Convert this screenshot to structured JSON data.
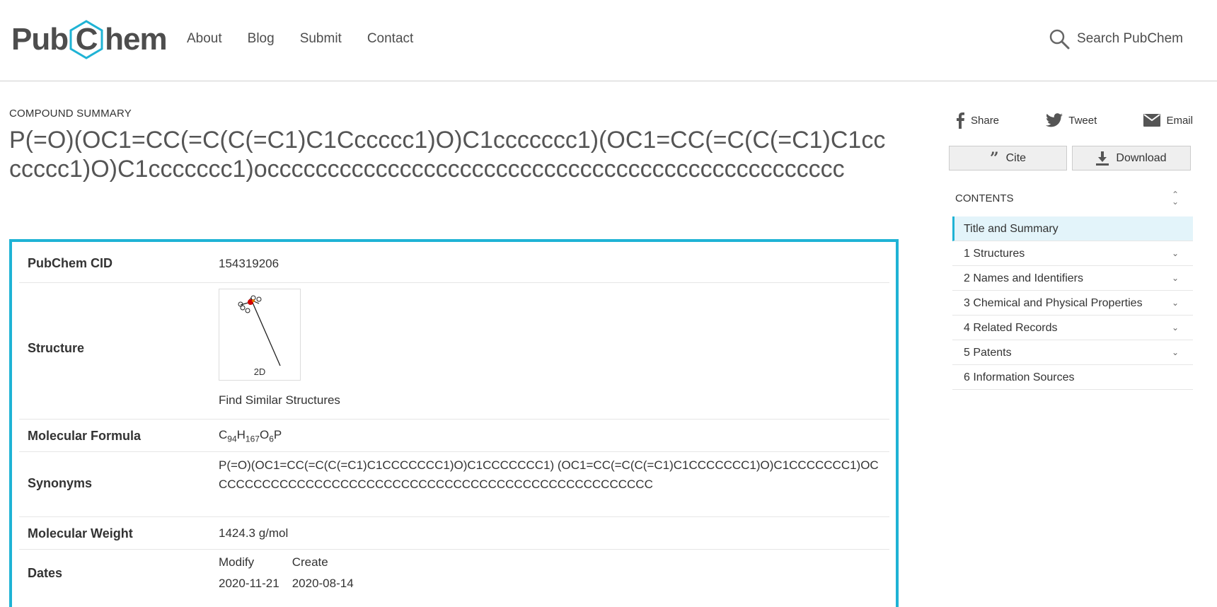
{
  "header": {
    "logo_left": "Pub",
    "logo_mid": "C",
    "logo_right": "hem",
    "nav": [
      "About",
      "Blog",
      "Submit",
      "Contact"
    ],
    "search_label": "Search PubChem"
  },
  "page": {
    "kicker": "COMPOUND SUMMARY",
    "title": "P(=O)(OC1=CC(=C(C(=C1)C1Cccccc1)O)C1ccccccc1)(OC1=CC(=C(C(=C1)C1ccccccc1)O)C1ccccccc1)occcccccccccccccccccccccccccccccccccccccccccccccc"
  },
  "summary": {
    "cid_label": "PubChem CID",
    "cid_value": "154319206",
    "structure_label": "Structure",
    "structure_caption": "2D",
    "find_similar": "Find Similar Structures",
    "formula_label": "Molecular Formula",
    "formula": {
      "c": "C",
      "c_n": "94",
      "h": "H",
      "h_n": "167",
      "o": "O",
      "o_n": "6",
      "p": "P"
    },
    "synonyms_label": "Synonyms",
    "synonym": "P(=O)(OC1=CC(=C(C(=C1)C1CCCCCCC1)O)C1CCCCCCC1) (OC1=CC(=C(C(=C1)C1CCCCCCC1)O)C1CCCCCCC1)OCCCCCCCCCCCCCCCCCCCCCCCCCCCCCCCCCCCCCCCCCCCCCCCCCCC",
    "mw_label": "Molecular Weight",
    "mw_value": "1424.3 g/mol",
    "dates_label": "Dates",
    "modify_label": "Modify",
    "modify_value": "2020-11-21",
    "create_label": "Create",
    "create_value": "2020-08-14"
  },
  "sidebar": {
    "share": "Share",
    "tweet": "Tweet",
    "email": "Email",
    "cite": "Cite",
    "download": "Download",
    "contents_title": "CONTENTS",
    "toc": [
      {
        "label": "Title and Summary",
        "has_chevron": false
      },
      {
        "label": "1 Structures",
        "has_chevron": true
      },
      {
        "label": "2 Names and Identifiers",
        "has_chevron": true
      },
      {
        "label": "3 Chemical and Physical Properties",
        "has_chevron": true
      },
      {
        "label": "4 Related Records",
        "has_chevron": true
      },
      {
        "label": "5 Patents",
        "has_chevron": true
      },
      {
        "label": "6 Information Sources",
        "has_chevron": false
      }
    ]
  },
  "colors": {
    "accent": "#1fb3d5",
    "link": "#1e6eb8",
    "text": "#333333"
  }
}
